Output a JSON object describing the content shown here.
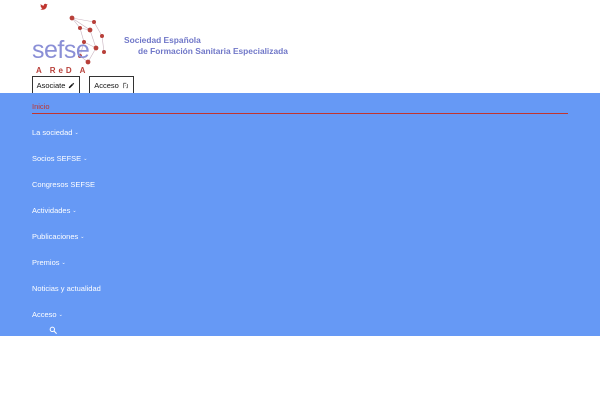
{
  "brand": {
    "logo_text": "sefse",
    "logo_sub": "A ReD A",
    "org_line1": "Sociedad Española",
    "org_line2": "de Formación Sanitaria Especializada"
  },
  "top_buttons": {
    "asociate": "Asociate",
    "acceso": "Acceso"
  },
  "nav": {
    "items": [
      {
        "label": "Inicio",
        "chevron": ""
      },
      {
        "label": "La sociedad",
        "chevron": "⌄"
      },
      {
        "label": "Socios SEFSE",
        "chevron": "⌄"
      },
      {
        "label": "Congresos SEFSE",
        "chevron": ""
      },
      {
        "label": "Actividades",
        "chevron": "⌄"
      },
      {
        "label": "Publicaciones",
        "chevron": "⌄"
      },
      {
        "label": "Premios",
        "chevron": "⌄"
      },
      {
        "label": "Noticias y actualidad",
        "chevron": ""
      },
      {
        "label": "Acceso",
        "chevron": "⌄"
      }
    ]
  },
  "colors": {
    "nav_bg": "#6699f5",
    "accent_red": "#c0352f",
    "logo_purple": "#8a8fd6"
  },
  "icons": {
    "social": "twitter-icon",
    "asociate": "pencil-icon",
    "acceso": "door-icon",
    "search": "search-icon"
  }
}
